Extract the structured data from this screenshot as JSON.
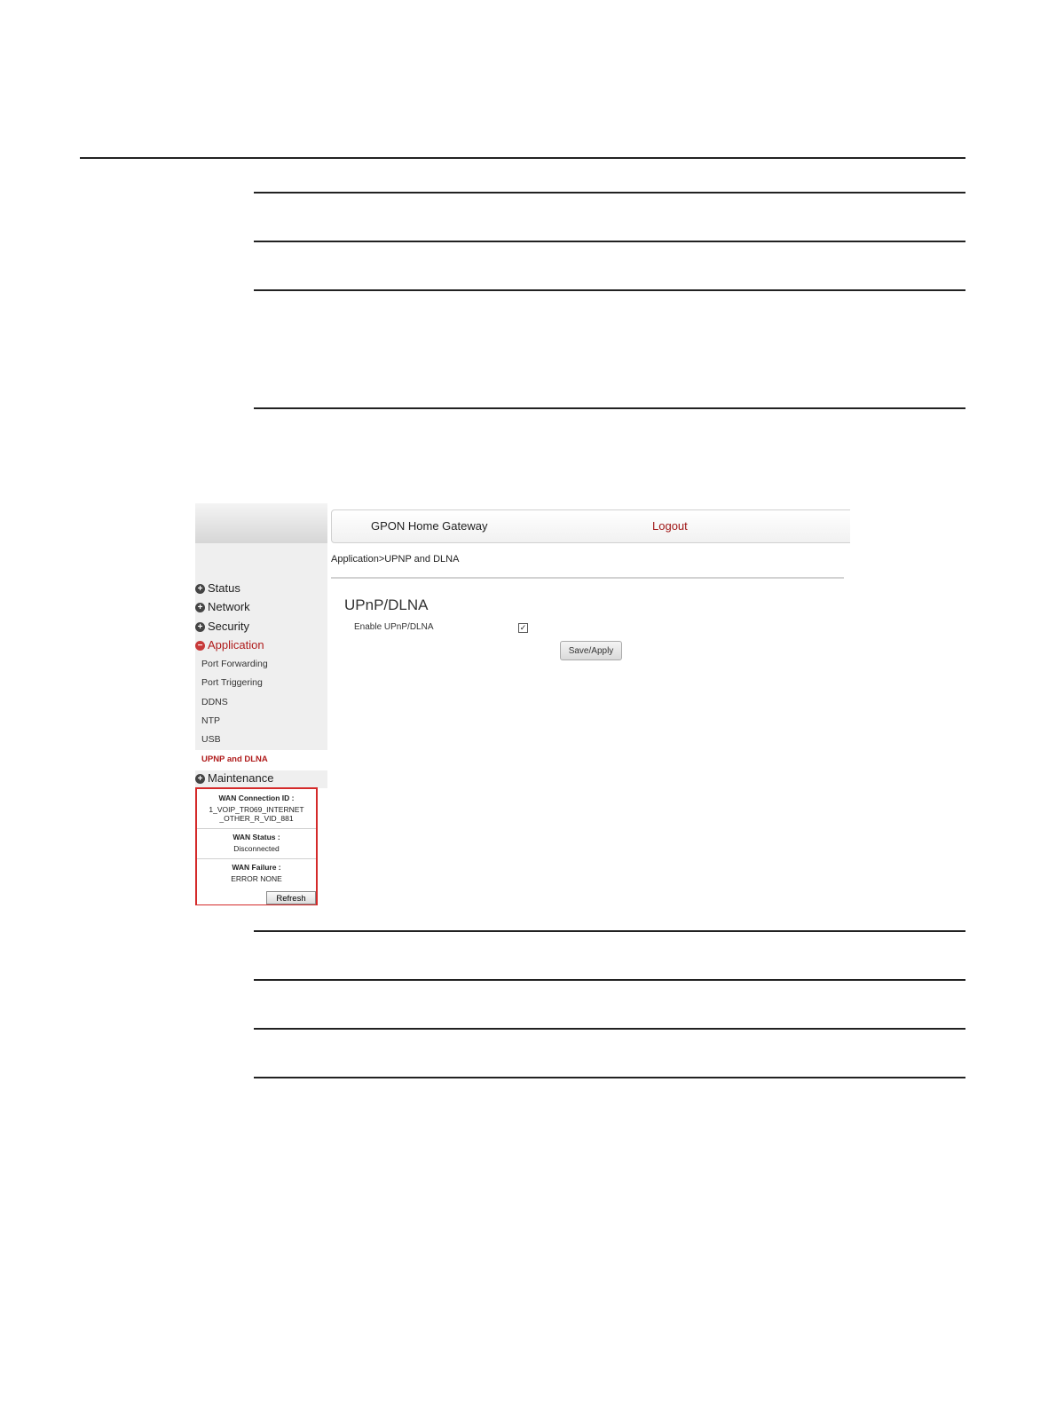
{
  "app": {
    "title": "GPON Home Gateway",
    "logout_label": "Logout"
  },
  "breadcrumb": "Application>UPNP and DLNA",
  "sidebar": {
    "items": [
      {
        "label": "Status",
        "state": "+"
      },
      {
        "label": "Network",
        "state": "+"
      },
      {
        "label": "Security",
        "state": "+"
      },
      {
        "label": "Application",
        "state": "−"
      }
    ],
    "application_subitems": [
      "Port Forwarding",
      "Port Triggering",
      "DDNS",
      "NTP",
      "USB",
      "UPNP and DLNA"
    ],
    "maintenance": {
      "label": "Maintenance",
      "state": "+"
    }
  },
  "status_panel": {
    "wan_connection_id_label": "WAN Connection ID :",
    "wan_connection_id_line1": "1_VOIP_TR069_INTERNET",
    "wan_connection_id_line2": "_OTHER_R_VID_881",
    "wan_status_label": "WAN Status :",
    "wan_status_value": "Disconnected",
    "wan_failure_label": "WAN Failure :",
    "wan_failure_value": "ERROR NONE",
    "refresh_label": "Refresh"
  },
  "main": {
    "section_title": "UPnP/DLNA",
    "enable_label": "Enable UPnP/DLNA",
    "enable_checkmark": "✓",
    "save_label": "Save/Apply"
  },
  "colors": {
    "accent_red": "#b01c1c",
    "status_border": "#d42a2a"
  }
}
